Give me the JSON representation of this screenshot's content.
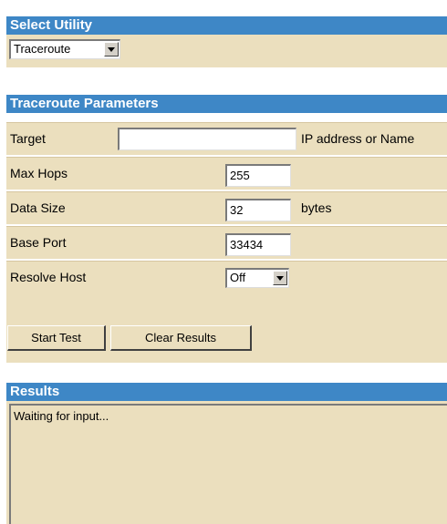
{
  "select_utility": {
    "header": "Select Utility",
    "selected": "Traceroute"
  },
  "traceroute": {
    "header": "Traceroute Parameters",
    "target": {
      "label": "Target",
      "value": "",
      "hint": "IP address or Name"
    },
    "max_hops": {
      "label": "Max Hops",
      "value": "255"
    },
    "data_size": {
      "label": "Data Size",
      "value": "32",
      "unit": "bytes"
    },
    "base_port": {
      "label": "Base Port",
      "value": "33434"
    },
    "resolve_host": {
      "label": "Resolve Host",
      "selected": "Off"
    }
  },
  "buttons": {
    "start": "Start Test",
    "clear": "Clear Results"
  },
  "results": {
    "header": "Results",
    "text": "Waiting for input..."
  },
  "colors": {
    "header_bg": "#3e87c6",
    "panel_bg": "#ebdfbe"
  }
}
